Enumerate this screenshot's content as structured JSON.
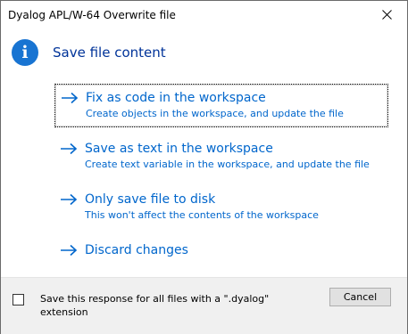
{
  "window": {
    "title": "Dyalog APL/W-64 Overwrite file"
  },
  "header": {
    "text": "Save file content",
    "icon": "info-icon"
  },
  "commands": [
    {
      "title": "Fix as code in the workspace",
      "description": "Create objects in the workspace, and update the file",
      "focused": true
    },
    {
      "title": "Save as text in the workspace",
      "description": "Create text variable in the workspace, and update the file"
    },
    {
      "title": "Only save file to disk",
      "description": "This won't affect the contents of the workspace"
    },
    {
      "title": "Discard changes",
      "description": ""
    }
  ],
  "footer": {
    "checkbox_label": "Save this response for all files with a \".dyalog\" extension",
    "checkbox_checked": false,
    "cancel_label": "Cancel"
  },
  "colors": {
    "accent": "#0066cc",
    "header": "#003399",
    "info_icon": "#1874d2"
  }
}
